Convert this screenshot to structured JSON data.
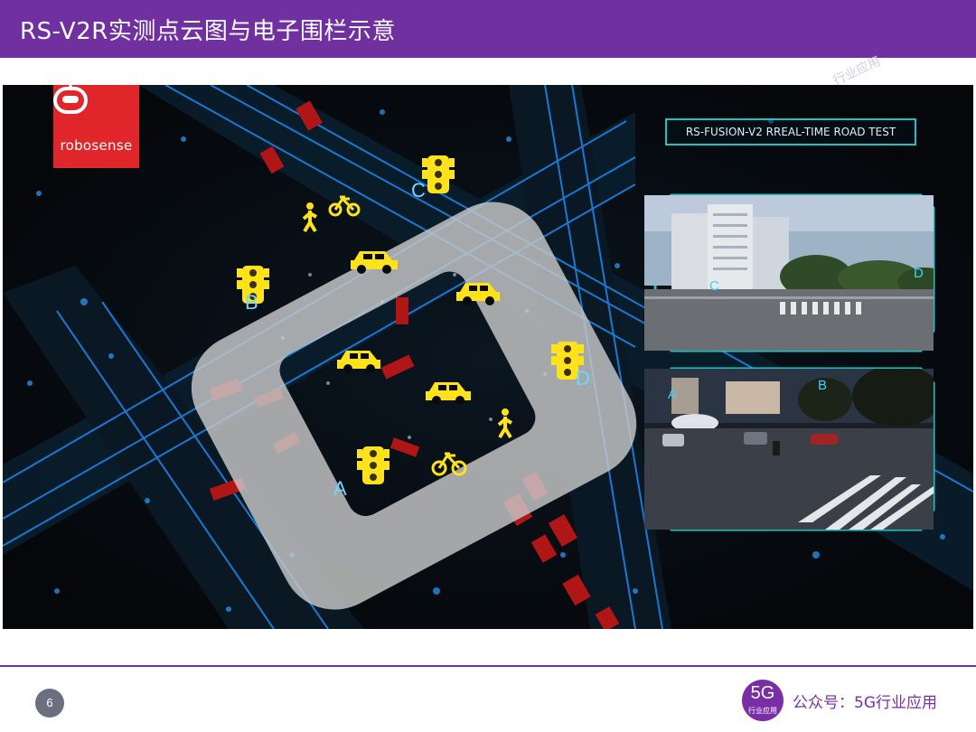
{
  "header": {
    "title": "RS-V2R实测点云图与电子围栏示意"
  },
  "logo": {
    "text": "robosense"
  },
  "banner": {
    "text": "RS-FUSION-V2 RREAL-TIME ROAD TEST"
  },
  "zones": {
    "a": "A",
    "b": "B",
    "c": "C",
    "d": "D"
  },
  "camera_top": {
    "label_c": "C",
    "label_d": "D"
  },
  "camera_bottom": {
    "label_a": "A",
    "label_b": "B"
  },
  "watermark": {
    "text": "行业应用"
  },
  "footer": {
    "page": "6",
    "badge_big": "5G",
    "badge_small": "行业应用",
    "brand": "公众号：5G行业应用"
  },
  "colors": {
    "accent": "#7030a0",
    "fence": "#c8c8c8",
    "marker": "#ffe21a",
    "point_cloud": "#1e90ff",
    "frame": "#1ec4c4"
  }
}
